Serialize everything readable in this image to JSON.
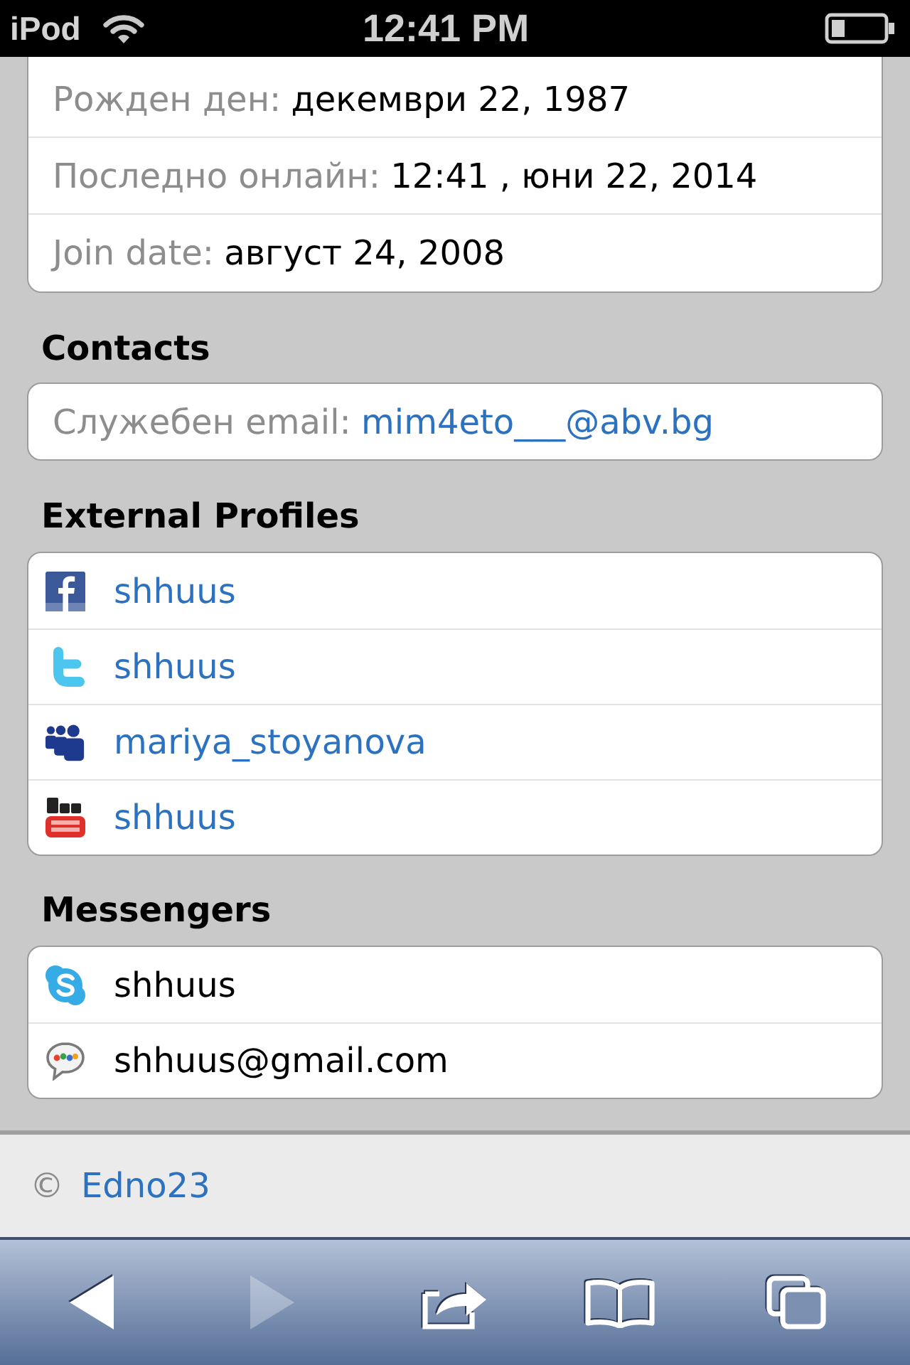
{
  "status_bar": {
    "device": "iPod",
    "time": "12:41 PM"
  },
  "details": [
    {
      "label": "Рожден ден:",
      "value": "декември 22, 1987"
    },
    {
      "label": "Последно онлайн:",
      "value": "12:41 , юни 22, 2014"
    },
    {
      "label": "Join date:",
      "value": "август 24, 2008"
    }
  ],
  "contacts": {
    "title": "Contacts",
    "items": [
      {
        "label": "Служебен email:",
        "value": "mim4eto___@abv.bg"
      }
    ]
  },
  "external_profiles": {
    "title": "External Profiles",
    "items": [
      {
        "kind": "facebook",
        "name": "shhuus"
      },
      {
        "kind": "twitter",
        "name": "shhuus"
      },
      {
        "kind": "myspace",
        "name": "mariya_stoyanova"
      },
      {
        "kind": "youtube",
        "name": "shhuus"
      }
    ]
  },
  "messengers": {
    "title": "Messengers",
    "items": [
      {
        "kind": "skype",
        "name": "shhuus"
      },
      {
        "kind": "gtalk",
        "name": "shhuus@gmail.com"
      }
    ]
  },
  "footer": {
    "symbol": "©",
    "link": "Edno23"
  },
  "toolbar": [
    {
      "kind": "back",
      "disabled": false
    },
    {
      "kind": "forward",
      "disabled": true
    },
    {
      "kind": "share",
      "disabled": false
    },
    {
      "kind": "bookmarks",
      "disabled": false
    },
    {
      "kind": "tabs",
      "disabled": false
    }
  ]
}
